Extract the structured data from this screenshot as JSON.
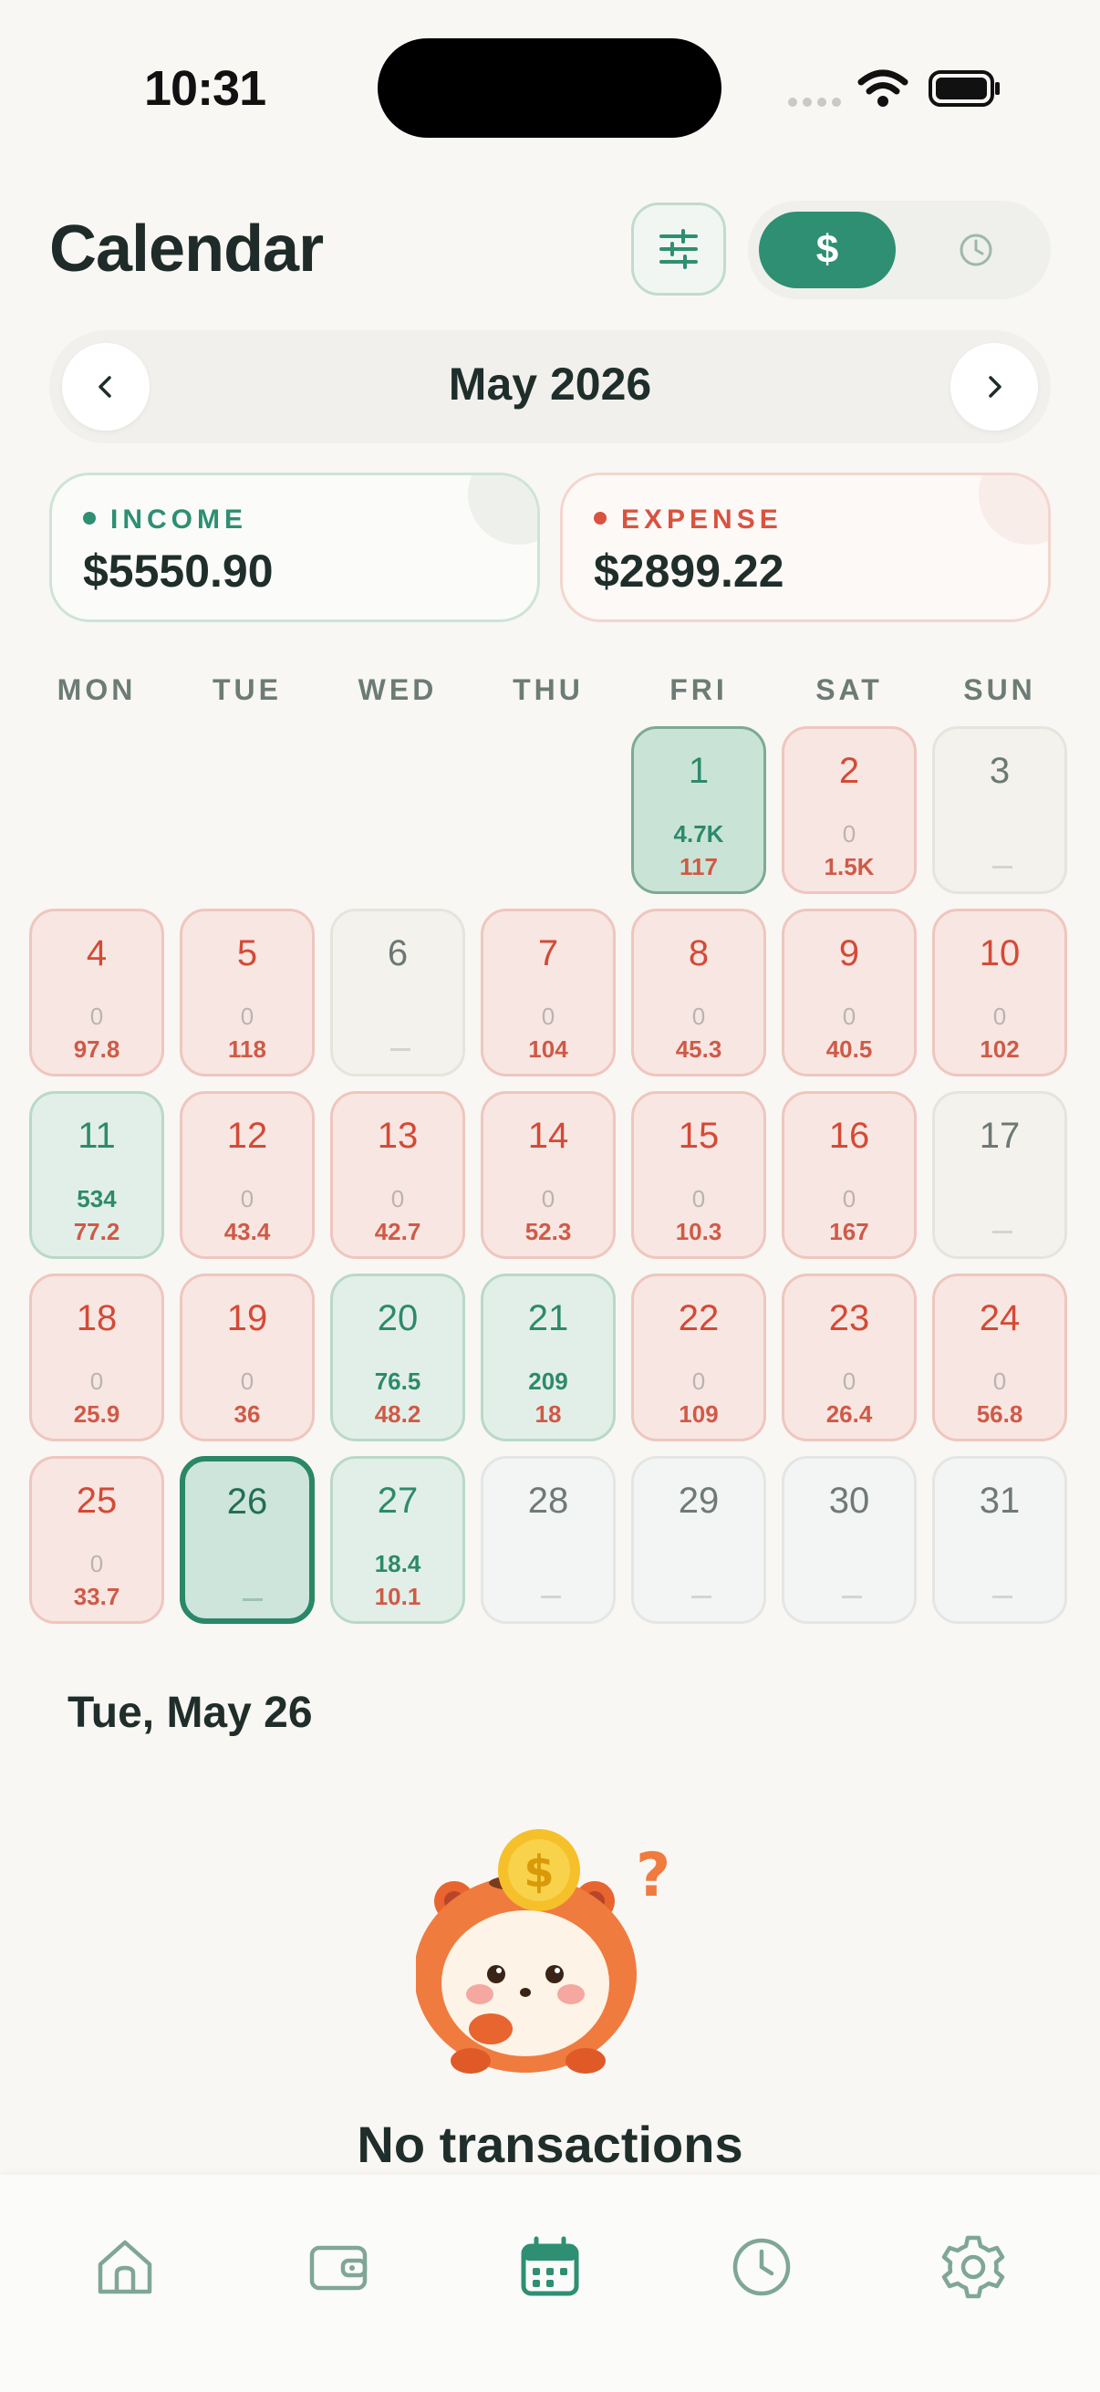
{
  "status_bar": {
    "time": "10:31"
  },
  "header": {
    "title": "Calendar",
    "mode_money_symbol": "$"
  },
  "month_nav": {
    "label": "May 2026"
  },
  "summary": {
    "income": {
      "label": "INCOME",
      "amount": "$5550.90"
    },
    "expense": {
      "label": "EXPENSE",
      "amount": "$2899.22"
    }
  },
  "weekdays": [
    "MON",
    "TUE",
    "WED",
    "THU",
    "FRI",
    "SAT",
    "SUN"
  ],
  "days": [
    {
      "day": "1",
      "income": "4.7K",
      "expense": "117",
      "kind": "income-strong"
    },
    {
      "day": "2",
      "income": "0",
      "expense": "1.5K",
      "kind": "expense"
    },
    {
      "day": "3",
      "income": "",
      "expense": "",
      "kind": "empty"
    },
    {
      "day": "4",
      "income": "0",
      "expense": "97.8",
      "kind": "expense"
    },
    {
      "day": "5",
      "income": "0",
      "expense": "118",
      "kind": "expense"
    },
    {
      "day": "6",
      "income": "",
      "expense": "",
      "kind": "empty"
    },
    {
      "day": "7",
      "income": "0",
      "expense": "104",
      "kind": "expense"
    },
    {
      "day": "8",
      "income": "0",
      "expense": "45.3",
      "kind": "expense"
    },
    {
      "day": "9",
      "income": "0",
      "expense": "40.5",
      "kind": "expense"
    },
    {
      "day": "10",
      "income": "0",
      "expense": "102",
      "kind": "expense"
    },
    {
      "day": "11",
      "income": "534",
      "expense": "77.2",
      "kind": "income"
    },
    {
      "day": "12",
      "income": "0",
      "expense": "43.4",
      "kind": "expense"
    },
    {
      "day": "13",
      "income": "0",
      "expense": "42.7",
      "kind": "expense"
    },
    {
      "day": "14",
      "income": "0",
      "expense": "52.3",
      "kind": "expense"
    },
    {
      "day": "15",
      "income": "0",
      "expense": "10.3",
      "kind": "expense"
    },
    {
      "day": "16",
      "income": "0",
      "expense": "167",
      "kind": "expense"
    },
    {
      "day": "17",
      "income": "",
      "expense": "",
      "kind": "empty"
    },
    {
      "day": "18",
      "income": "0",
      "expense": "25.9",
      "kind": "expense"
    },
    {
      "day": "19",
      "income": "0",
      "expense": "36",
      "kind": "expense"
    },
    {
      "day": "20",
      "income": "76.5",
      "expense": "48.2",
      "kind": "income"
    },
    {
      "day": "21",
      "income": "209",
      "expense": "18",
      "kind": "income"
    },
    {
      "day": "22",
      "income": "0",
      "expense": "109",
      "kind": "expense"
    },
    {
      "day": "23",
      "income": "0",
      "expense": "26.4",
      "kind": "expense"
    },
    {
      "day": "24",
      "income": "0",
      "expense": "56.8",
      "kind": "expense"
    },
    {
      "day": "25",
      "income": "0",
      "expense": "33.7",
      "kind": "expense"
    },
    {
      "day": "26",
      "income": "",
      "expense": "",
      "kind": "selected"
    },
    {
      "day": "27",
      "income": "18.4",
      "expense": "10.1",
      "kind": "income"
    },
    {
      "day": "28",
      "income": "",
      "expense": "",
      "kind": "future"
    },
    {
      "day": "29",
      "income": "",
      "expense": "",
      "kind": "future"
    },
    {
      "day": "30",
      "income": "",
      "expense": "",
      "kind": "future"
    },
    {
      "day": "31",
      "income": "",
      "expense": "",
      "kind": "future"
    }
  ],
  "selected_day": {
    "label": "Tue, May 26"
  },
  "empty_state": {
    "title": "No transactions"
  },
  "tabs": [
    {
      "name": "home",
      "icon": "home-icon",
      "active": false
    },
    {
      "name": "wallet",
      "icon": "wallet-icon",
      "active": false
    },
    {
      "name": "calendar",
      "icon": "calendar-icon",
      "active": true
    },
    {
      "name": "history",
      "icon": "clock-icon",
      "active": false
    },
    {
      "name": "settings",
      "icon": "gear-icon",
      "active": false
    }
  ],
  "colors": {
    "accent_green": "#2E8F72",
    "expense_red": "#D9533F",
    "background": "#F8F7F4",
    "tab_inactive": "#7FA698"
  }
}
